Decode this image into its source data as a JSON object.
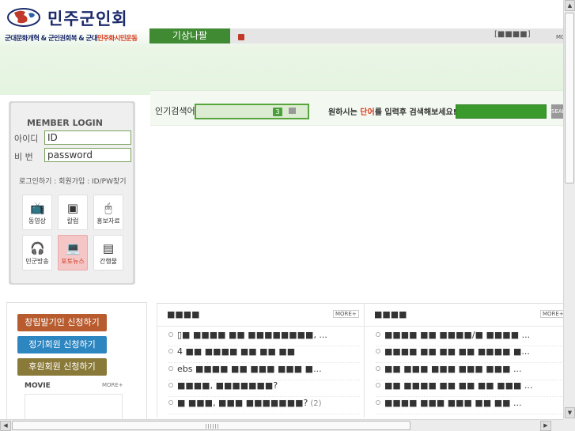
{
  "header": {
    "logo_title": "민주군인회",
    "logo_sub_1": "군대문화개혁 & 군인권회복 & 군대",
    "logo_sub_2": "민주화시민운동",
    "nav_tab": "기상나팔",
    "nav_placeholder": "[■■■■]",
    "nav_more": "MORE"
  },
  "login": {
    "title": "MEMBER LOGIN",
    "id_label": "아이디",
    "pw_label": "비  번",
    "id_value": "ID",
    "pw_value": "password",
    "links": "로그인하기 : 회원가입 : ID/PW찾기",
    "icons": [
      {
        "label": "동영상",
        "icon": "tv-icon",
        "glyph": "📺"
      },
      {
        "label": "칼럼",
        "icon": "column-icon",
        "glyph": "▣"
      },
      {
        "label": "홍보자료",
        "icon": "mouse-icon",
        "glyph": "🖱"
      },
      {
        "label": "민군방송",
        "icon": "headphones-icon",
        "glyph": "🎧"
      },
      {
        "label": "포토뉴스",
        "icon": "laptop-icon",
        "glyph": "💻"
      },
      {
        "label": "간행물",
        "icon": "document-icon",
        "glyph": "▤"
      }
    ]
  },
  "join": {
    "founder": "창립발기인 신청하기",
    "regular": "정기회원 신청하기",
    "supporter": "후원회원 신청하기",
    "colors": {
      "founder": "#b85c2f",
      "regular": "#2e86c1",
      "supporter": "#8a7a3a"
    }
  },
  "movie": {
    "title": "MOVIE",
    "more": "MORE+"
  },
  "search": {
    "popular_label": "인기검색어",
    "popular_rank": "3",
    "hint_prefix": "원하시는 ",
    "hint_red": "단어",
    "hint_suffix": "를 입력후 검색해보세요!",
    "button": "SEARCH"
  },
  "boards": [
    {
      "title": "■■■■",
      "more": "MORE+",
      "items": [
        {
          "text": "▯■ ■■■■ ■■ ■■■■■■■■, ...",
          "count": ""
        },
        {
          "text": "4 ■■ ■■■■ ■■ ■■ ■■",
          "count": ""
        },
        {
          "text": "ebs ■■■■ ■■ ■■■ ■■■ ■...",
          "count": ""
        },
        {
          "text": "■■■■, ■■■■■■■?",
          "count": ""
        },
        {
          "text": "■ ■■■, ■■■ ■■■■■■■?",
          "count": "(2)"
        }
      ]
    },
    {
      "title": "■■■■",
      "more": "MORE+",
      "items": [
        {
          "text": "■■■■ ■■ ■■■■/■ ■■■■ ...",
          "count": ""
        },
        {
          "text": "■■■■ ■■ ■■ ■■ ■■■■ ■...",
          "count": ""
        },
        {
          "text": "■■ ■■■ ■■■ ■■■ ■■■ ...",
          "count": ""
        },
        {
          "text": "■■ ■■■■ ■■ ■■ ■■ ■■■ ...",
          "count": ""
        },
        {
          "text": "■■■■ ■■■ ■■■ ■■ ■■ ...",
          "count": ""
        }
      ]
    }
  ],
  "colors": {
    "accent": "#3f8a32",
    "brand": "#1b2a6b",
    "highlight": "#d83a1f"
  }
}
